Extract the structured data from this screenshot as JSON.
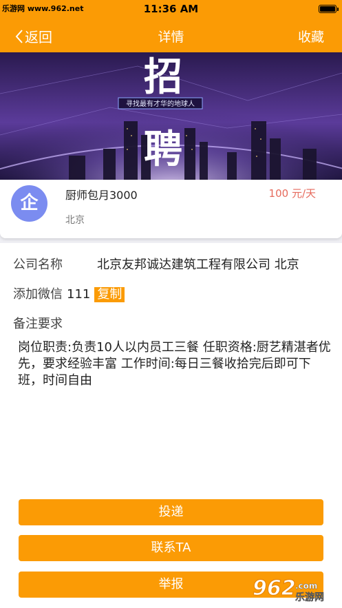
{
  "status_bar": {
    "watermark": "乐游网 www.962.net",
    "time": "11:36 AM"
  },
  "nav": {
    "back_label": "返回",
    "title": "详情",
    "favorite_label": "收藏"
  },
  "banner": {
    "big_char_top": "招",
    "big_char_bottom": "聘",
    "slogan": "寻找最有才华的地球人"
  },
  "job": {
    "avatar_char": "企",
    "title": "厨师包月3000",
    "salary": "100 元/天",
    "location": "北京"
  },
  "details": {
    "company_label": "公司名称",
    "company_value": "北京友邦诚达建筑工程有限公司 北京",
    "wechat_label": "添加微信",
    "wechat_value": "111",
    "copy_label": "复制",
    "remark_label": "备注要求",
    "remark_text": "岗位职责:负责10人以内员工三餐 任职资格:厨艺精湛者优先，要求经验丰富 工作时间:每日三餐收拾完后即可下班，时间自由"
  },
  "actions": {
    "deliver": "投递",
    "contact": "联系TA",
    "report": "举报"
  },
  "logo_watermark": {
    "brand": "962",
    "suffix": ".com",
    "cn": "乐游网"
  },
  "colors": {
    "accent": "#FB9B05",
    "salary": "#E66A5C",
    "avatar": "#7B8CF0"
  }
}
